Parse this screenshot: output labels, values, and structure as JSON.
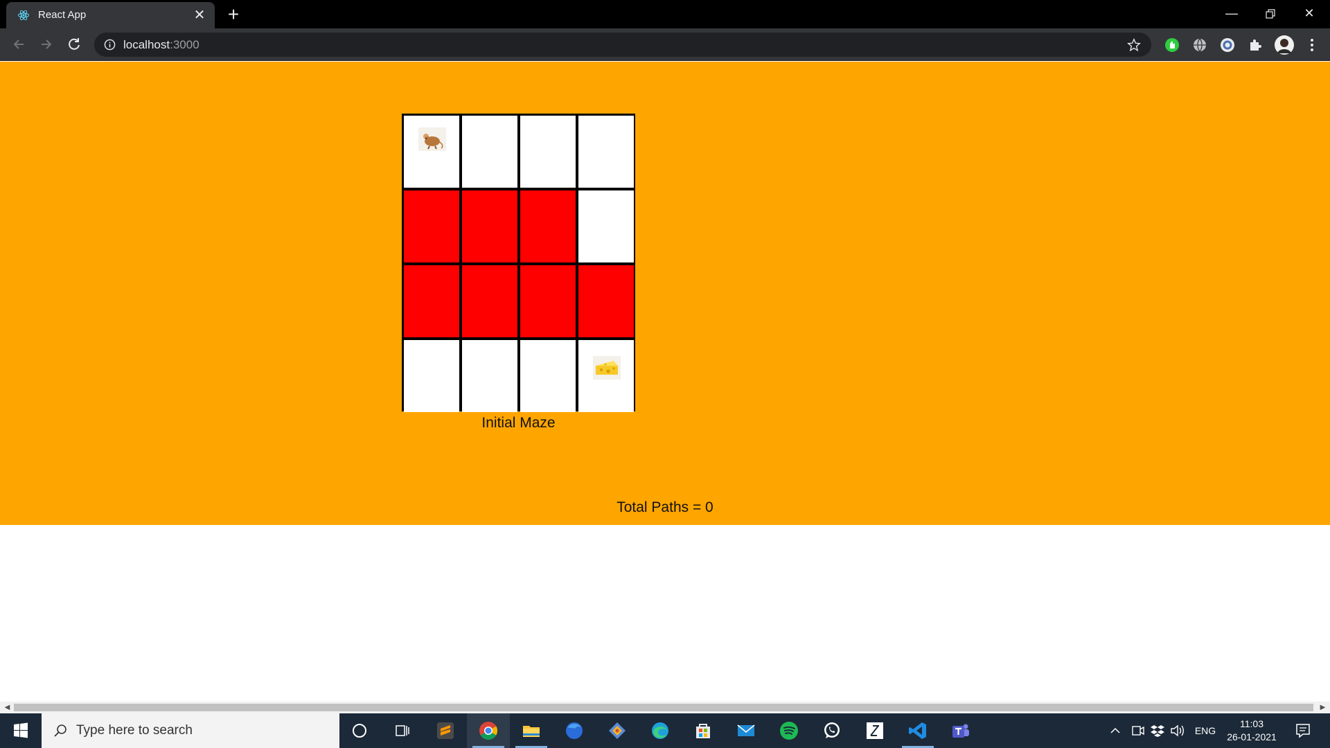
{
  "browser": {
    "tab_title": "React App",
    "url_host": "localhost",
    "url_port": ":3000",
    "window_controls": {
      "minimize_icon": "minimize-icon",
      "restore_icon": "restore-icon",
      "close_icon": "close-icon"
    }
  },
  "maze": {
    "caption": "Initial Maze",
    "rows": [
      [
        "start",
        "open",
        "open",
        "open"
      ],
      [
        "wall",
        "wall",
        "wall",
        "open"
      ],
      [
        "wall",
        "wall",
        "wall",
        "wall"
      ],
      [
        "open",
        "open",
        "open",
        "goal"
      ]
    ],
    "start_icon": "mouse-icon",
    "goal_icon": "cheese-icon",
    "colors": {
      "open": "#ffffff",
      "wall": "#ff0000",
      "background": "#ffa500"
    }
  },
  "result": {
    "total_paths": "Total Paths = 0"
  },
  "taskbar": {
    "search_placeholder": "Type here to search",
    "apps": [
      "cortana-icon",
      "task-view-icon",
      "sublime-text-icon",
      "chrome-icon",
      "file-explorer-icon",
      "firefox-icon",
      "git-icon",
      "edge-icon",
      "store-icon",
      "mail-icon",
      "spotify-icon",
      "whatsapp-icon",
      "terminal-icon",
      "vscode-icon",
      "teams-icon"
    ],
    "language": "ENG",
    "time": "11:03",
    "date": "26-01-2021"
  }
}
